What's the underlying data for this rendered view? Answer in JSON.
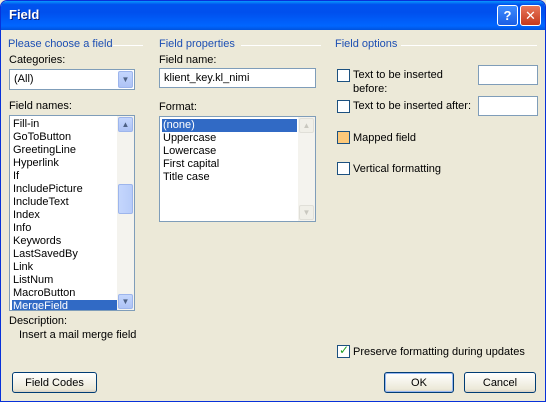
{
  "window": {
    "title": "Field"
  },
  "titlebar": {
    "help_label": "?",
    "close_label": "✕"
  },
  "left": {
    "heading": "Please choose a field",
    "categories_label": "Categories:",
    "categories_value": "(All)",
    "field_names_label": "Field names:",
    "field_names": [
      "Fill-in",
      "GoToButton",
      "GreetingLine",
      "Hyperlink",
      "If",
      "IncludePicture",
      "IncludeText",
      "Index",
      "Info",
      "Keywords",
      "LastSavedBy",
      "Link",
      "ListNum",
      "MacroButton",
      "MergeField"
    ],
    "selected_field": "MergeField",
    "description_label": "Description:",
    "description_text": "Insert a mail merge field"
  },
  "middle": {
    "heading": "Field properties",
    "field_name_label": "Field name:",
    "field_name_value": "klient_key.kl_nimi",
    "format_label": "Format:",
    "formats": [
      "(none)",
      "Uppercase",
      "Lowercase",
      "First capital",
      "Title case"
    ],
    "selected_format": "(none)"
  },
  "right": {
    "heading": "Field options",
    "opt_before_label_1": "Text to be inserted",
    "opt_before_label_2": "before:",
    "opt_before_value": "",
    "opt_after_label": "Text to be inserted after:",
    "opt_after_value": "",
    "mapped_label": "Mapped field",
    "vertical_label": "Vertical formatting",
    "preserve_label": "Preserve formatting during updates",
    "preserve_checked": true
  },
  "buttons": {
    "field_codes": "Field Codes",
    "ok": "OK",
    "cancel": "Cancel"
  },
  "colors": {
    "heading": "#1d4fb3",
    "selection": "#316ac5",
    "titlebar": "#0053ee"
  }
}
